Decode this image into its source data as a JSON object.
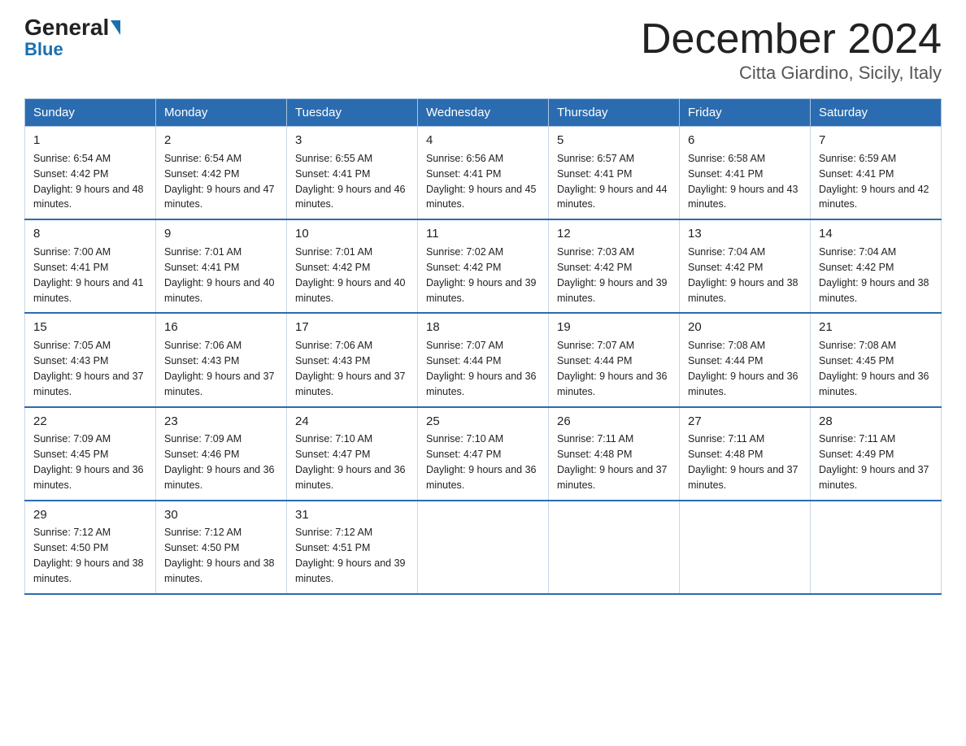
{
  "logo": {
    "part1": "General",
    "part2": "Blue"
  },
  "header": {
    "month": "December 2024",
    "location": "Citta Giardino, Sicily, Italy"
  },
  "days_of_week": [
    "Sunday",
    "Monday",
    "Tuesday",
    "Wednesday",
    "Thursday",
    "Friday",
    "Saturday"
  ],
  "weeks": [
    [
      {
        "day": "1",
        "sunrise": "6:54 AM",
        "sunset": "4:42 PM",
        "daylight": "9 hours and 48 minutes."
      },
      {
        "day": "2",
        "sunrise": "6:54 AM",
        "sunset": "4:42 PM",
        "daylight": "9 hours and 47 minutes."
      },
      {
        "day": "3",
        "sunrise": "6:55 AM",
        "sunset": "4:41 PM",
        "daylight": "9 hours and 46 minutes."
      },
      {
        "day": "4",
        "sunrise": "6:56 AM",
        "sunset": "4:41 PM",
        "daylight": "9 hours and 45 minutes."
      },
      {
        "day": "5",
        "sunrise": "6:57 AM",
        "sunset": "4:41 PM",
        "daylight": "9 hours and 44 minutes."
      },
      {
        "day": "6",
        "sunrise": "6:58 AM",
        "sunset": "4:41 PM",
        "daylight": "9 hours and 43 minutes."
      },
      {
        "day": "7",
        "sunrise": "6:59 AM",
        "sunset": "4:41 PM",
        "daylight": "9 hours and 42 minutes."
      }
    ],
    [
      {
        "day": "8",
        "sunrise": "7:00 AM",
        "sunset": "4:41 PM",
        "daylight": "9 hours and 41 minutes."
      },
      {
        "day": "9",
        "sunrise": "7:01 AM",
        "sunset": "4:41 PM",
        "daylight": "9 hours and 40 minutes."
      },
      {
        "day": "10",
        "sunrise": "7:01 AM",
        "sunset": "4:42 PM",
        "daylight": "9 hours and 40 minutes."
      },
      {
        "day": "11",
        "sunrise": "7:02 AM",
        "sunset": "4:42 PM",
        "daylight": "9 hours and 39 minutes."
      },
      {
        "day": "12",
        "sunrise": "7:03 AM",
        "sunset": "4:42 PM",
        "daylight": "9 hours and 39 minutes."
      },
      {
        "day": "13",
        "sunrise": "7:04 AM",
        "sunset": "4:42 PM",
        "daylight": "9 hours and 38 minutes."
      },
      {
        "day": "14",
        "sunrise": "7:04 AM",
        "sunset": "4:42 PM",
        "daylight": "9 hours and 38 minutes."
      }
    ],
    [
      {
        "day": "15",
        "sunrise": "7:05 AM",
        "sunset": "4:43 PM",
        "daylight": "9 hours and 37 minutes."
      },
      {
        "day": "16",
        "sunrise": "7:06 AM",
        "sunset": "4:43 PM",
        "daylight": "9 hours and 37 minutes."
      },
      {
        "day": "17",
        "sunrise": "7:06 AM",
        "sunset": "4:43 PM",
        "daylight": "9 hours and 37 minutes."
      },
      {
        "day": "18",
        "sunrise": "7:07 AM",
        "sunset": "4:44 PM",
        "daylight": "9 hours and 36 minutes."
      },
      {
        "day": "19",
        "sunrise": "7:07 AM",
        "sunset": "4:44 PM",
        "daylight": "9 hours and 36 minutes."
      },
      {
        "day": "20",
        "sunrise": "7:08 AM",
        "sunset": "4:44 PM",
        "daylight": "9 hours and 36 minutes."
      },
      {
        "day": "21",
        "sunrise": "7:08 AM",
        "sunset": "4:45 PM",
        "daylight": "9 hours and 36 minutes."
      }
    ],
    [
      {
        "day": "22",
        "sunrise": "7:09 AM",
        "sunset": "4:45 PM",
        "daylight": "9 hours and 36 minutes."
      },
      {
        "day": "23",
        "sunrise": "7:09 AM",
        "sunset": "4:46 PM",
        "daylight": "9 hours and 36 minutes."
      },
      {
        "day": "24",
        "sunrise": "7:10 AM",
        "sunset": "4:47 PM",
        "daylight": "9 hours and 36 minutes."
      },
      {
        "day": "25",
        "sunrise": "7:10 AM",
        "sunset": "4:47 PM",
        "daylight": "9 hours and 36 minutes."
      },
      {
        "day": "26",
        "sunrise": "7:11 AM",
        "sunset": "4:48 PM",
        "daylight": "9 hours and 37 minutes."
      },
      {
        "day": "27",
        "sunrise": "7:11 AM",
        "sunset": "4:48 PM",
        "daylight": "9 hours and 37 minutes."
      },
      {
        "day": "28",
        "sunrise": "7:11 AM",
        "sunset": "4:49 PM",
        "daylight": "9 hours and 37 minutes."
      }
    ],
    [
      {
        "day": "29",
        "sunrise": "7:12 AM",
        "sunset": "4:50 PM",
        "daylight": "9 hours and 38 minutes."
      },
      {
        "day": "30",
        "sunrise": "7:12 AM",
        "sunset": "4:50 PM",
        "daylight": "9 hours and 38 minutes."
      },
      {
        "day": "31",
        "sunrise": "7:12 AM",
        "sunset": "4:51 PM",
        "daylight": "9 hours and 39 minutes."
      },
      null,
      null,
      null,
      null
    ]
  ]
}
